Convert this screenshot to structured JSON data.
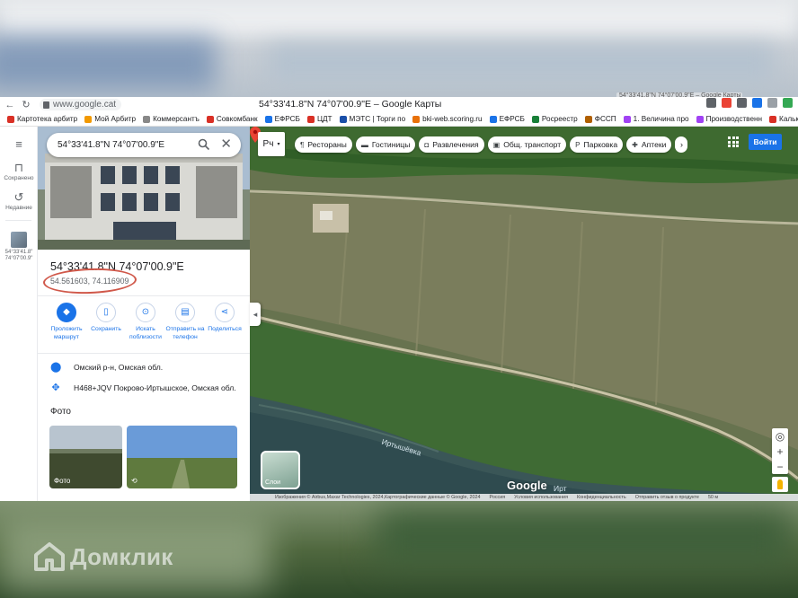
{
  "browser": {
    "url": "www.google.cat",
    "window_title": "54°33'41.8\"N 74°07'00.9\"E – Google Карты",
    "other_tab_title": "54°33'41.8\"N 74°07'00.9\"E – Google Карты",
    "bookmarks": [
      {
        "label": "Картотека арбитр",
        "color": "#d93025"
      },
      {
        "label": "Мой Арбитр",
        "color": "#f29900"
      },
      {
        "label": "Коммерсантъ",
        "color": "#888888"
      },
      {
        "label": "Совкомбанк",
        "color": "#d93025"
      },
      {
        "label": "ЕФРСБ",
        "color": "#1a73e8"
      },
      {
        "label": "ЦДТ",
        "color": "#d93025"
      },
      {
        "label": "МЭТС | Торги по",
        "color": "#1a4fa8"
      },
      {
        "label": "bki-web.scoring.ru",
        "color": "#e8710a"
      },
      {
        "label": "ЕФРСБ",
        "color": "#1a73e8"
      },
      {
        "label": "Росреестр",
        "color": "#188038"
      },
      {
        "label": "ФССП",
        "color": "#b06000"
      },
      {
        "label": "1. Величина про",
        "color": "#a142f4"
      },
      {
        "label": "Производственн",
        "color": "#a142f4"
      },
      {
        "label": "Кальку",
        "color": "#d93025"
      }
    ]
  },
  "rail": {
    "saved": "Сохранено",
    "recent": "Недавние",
    "recent_item": "54°33'41.8\" 74°07'00.9\""
  },
  "panel": {
    "search_value": "54°33'41.8\"N 74°07'00.9\"E",
    "place_title": "54°33'41.8\"N 74°07'00.9\"E",
    "decimal_coords": "54.561603, 74.116909",
    "actions": [
      {
        "label": "Проложить маршрут",
        "icon": "directions-icon",
        "primary": true
      },
      {
        "label": "Сохранить",
        "icon": "bookmark-icon",
        "primary": false
      },
      {
        "label": "Искать поблизости",
        "icon": "nearby-icon",
        "primary": false
      },
      {
        "label": "Отправить на телефон",
        "icon": "phone-icon",
        "primary": false
      },
      {
        "label": "Поделиться",
        "icon": "share-icon",
        "primary": false
      }
    ],
    "address": "Омский р-н, Омская обл.",
    "plus_code": "H468+JQV Покрово-Иртышское, Омская обл.",
    "photos_heading": "Фото",
    "photo_label": "Фото"
  },
  "map": {
    "map_type": "Рч",
    "chips": [
      {
        "label": "Рестораны",
        "icon": "restaurant-icon"
      },
      {
        "label": "Гостиницы",
        "icon": "hotel-icon"
      },
      {
        "label": "Развлечения",
        "icon": "camera-icon"
      },
      {
        "label": "Общ. транспорт",
        "icon": "transit-icon"
      },
      {
        "label": "Парковка",
        "icon": "parking-icon"
      },
      {
        "label": "Аптеки",
        "icon": "pharmacy-icon"
      }
    ],
    "signin": "Войти",
    "layers": "Слои",
    "river_name": "Иртышёвка",
    "river_name2": "Ирт",
    "google_logo": "Google",
    "footer": [
      "Изображения © Airbus,Maxar Technologies, 2024,Картографические данные © Google, 2024",
      "Россия",
      "Условия использования",
      "Конфиденциальность",
      "Отправить отзыв о продукте",
      "50 м"
    ]
  },
  "watermark": "Домклик"
}
